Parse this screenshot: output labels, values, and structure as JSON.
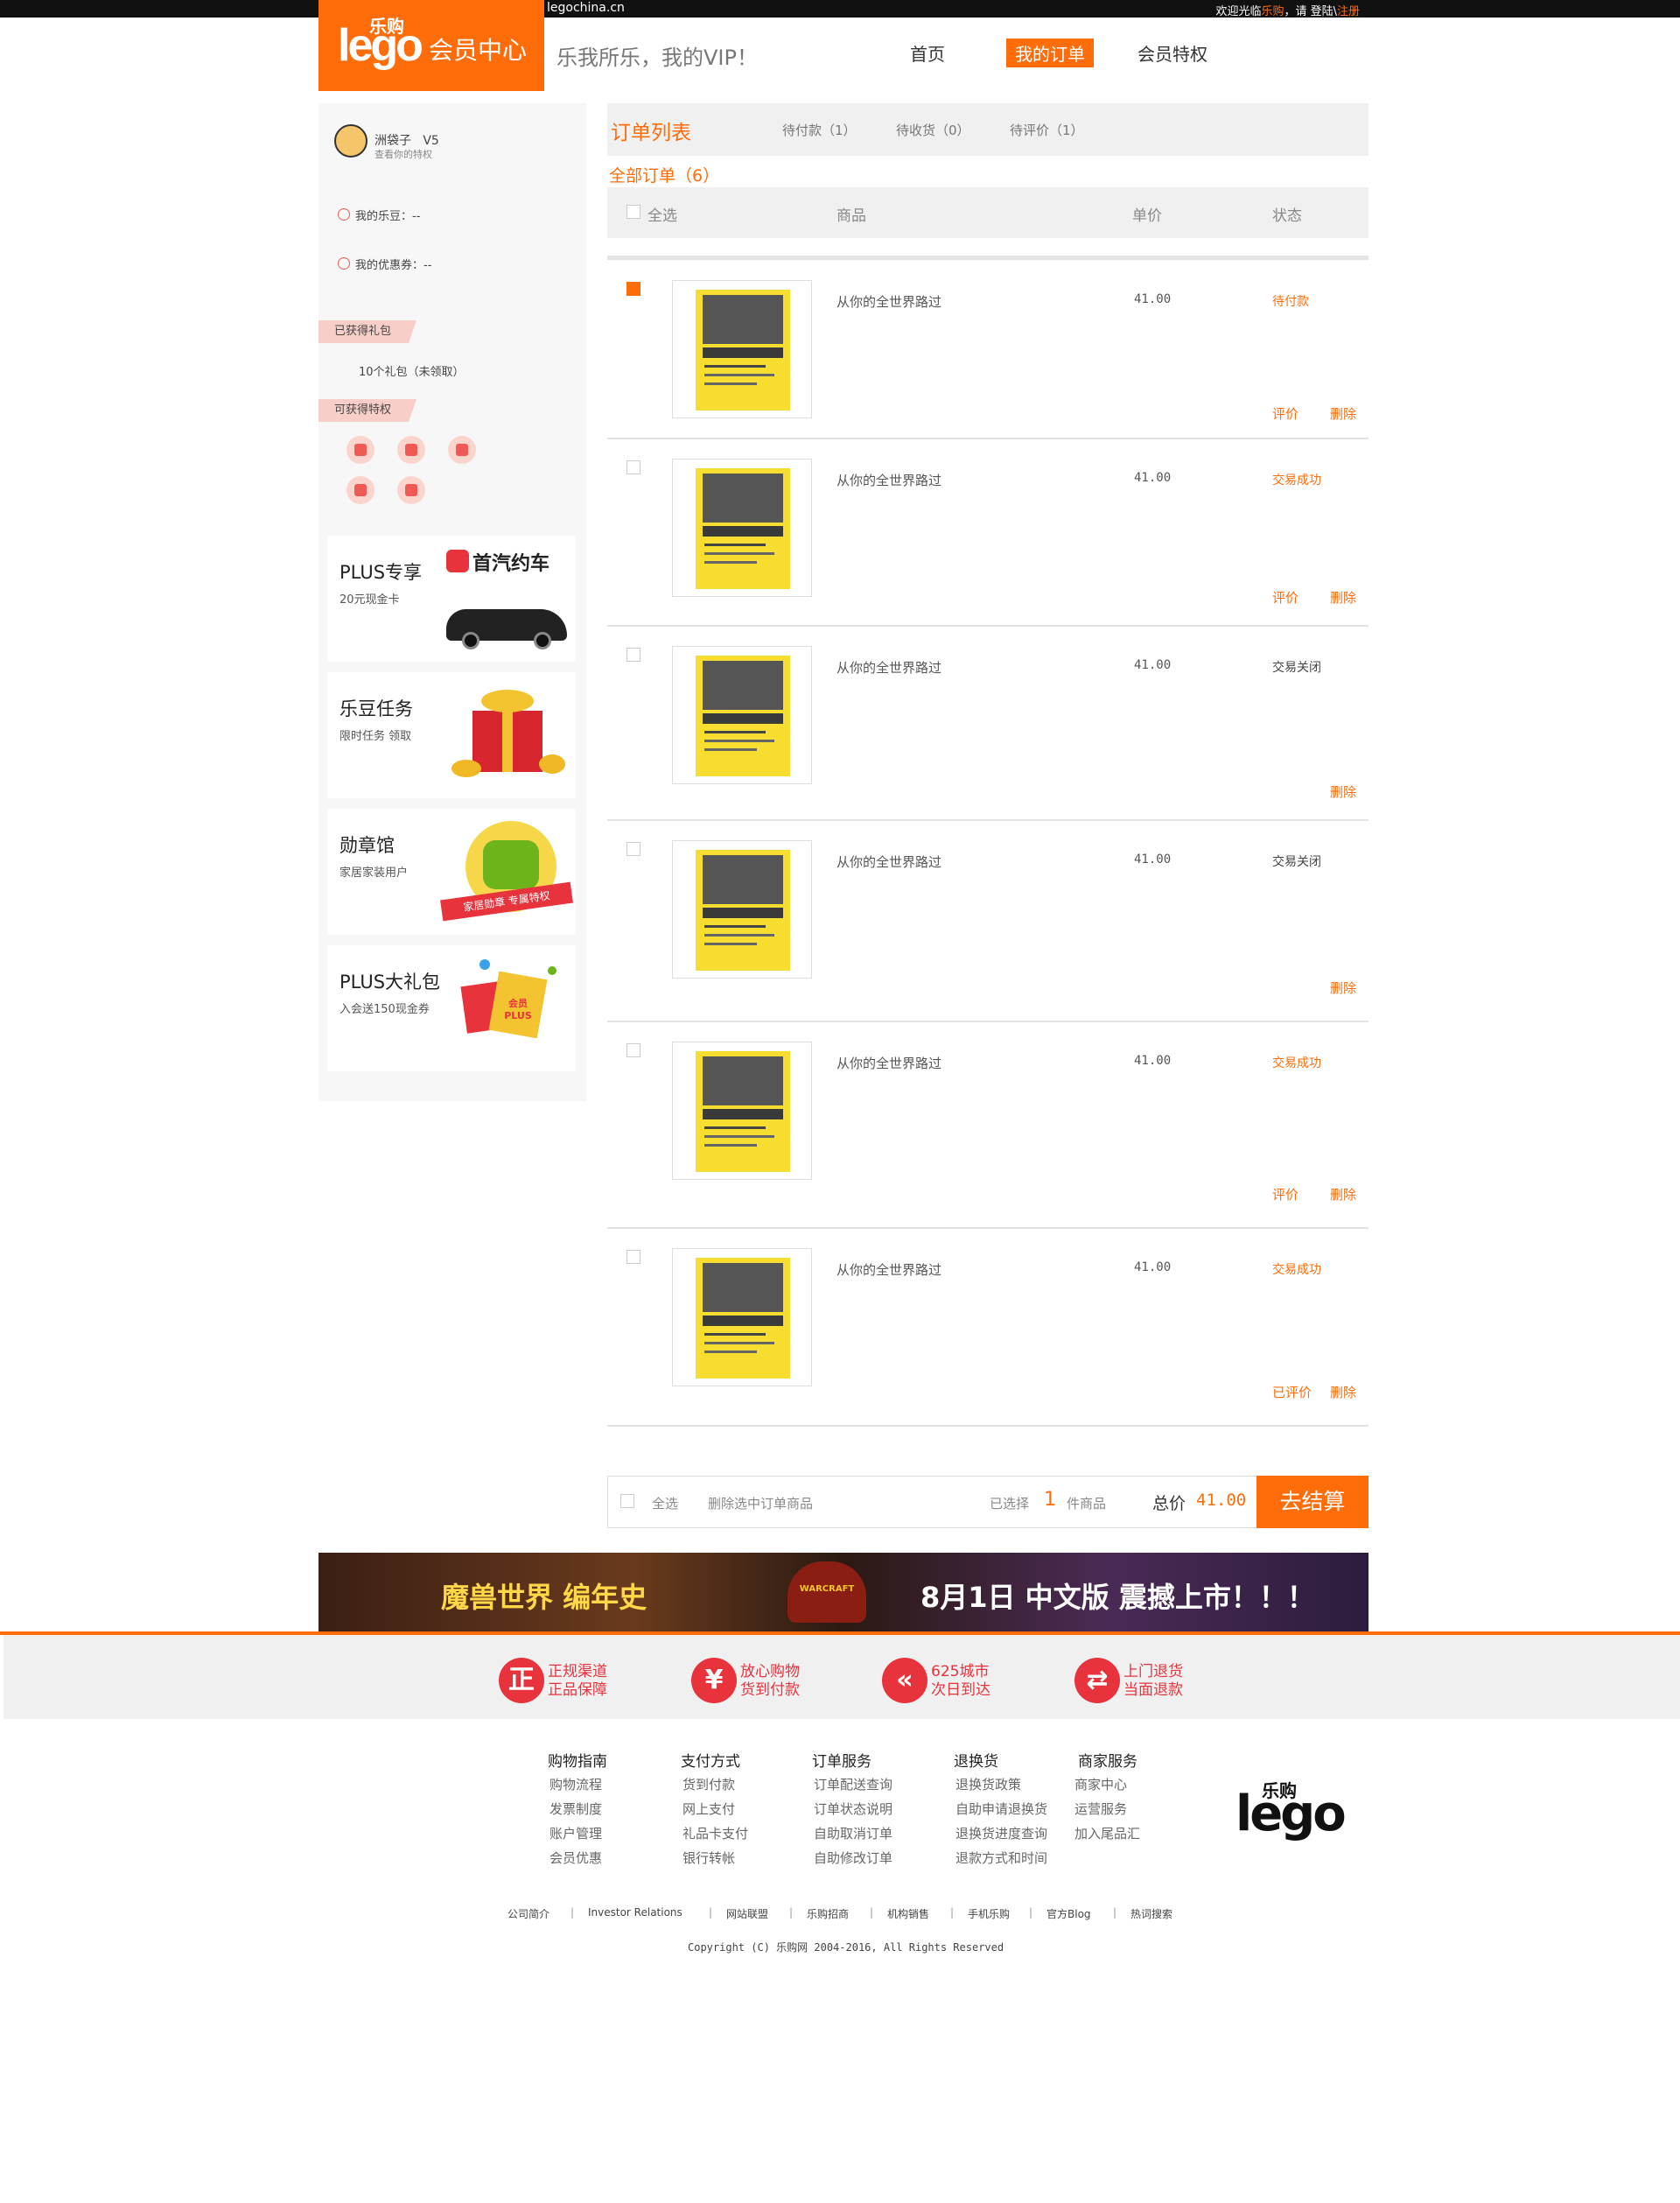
{
  "topbar": {
    "domain": "legochina.cn",
    "greeting_prefix": "欢迎光临",
    "greeting_brand": "乐购",
    "greeting_mid": "，请 登陆\\",
    "greeting_register": "注册"
  },
  "header": {
    "logo_text": "lego",
    "logo_cn": "乐购",
    "center_title": "会员中心",
    "slogan": "乐我所乐，我的VIP！",
    "nav": [
      "首页",
      "我的订单",
      "会员特权"
    ],
    "active_nav": "我的订单"
  },
  "sidebar": {
    "username": "洲袋子",
    "level": "V5",
    "view_privilege": "查看你的特权",
    "ledou_label": "我的乐豆：",
    "ledou_value": "--",
    "coupon_label": "我的优惠券：",
    "coupon_value": "--",
    "gifts_ribbon": "已获得礼包",
    "gifts_text": "10个礼包（未领取）",
    "privilege_ribbon": "可获得特权",
    "promos": [
      {
        "title": "PLUS专享",
        "subtitle": "20元现金卡",
        "brand": "首汽约车"
      },
      {
        "title": "乐豆任务",
        "subtitle": "限时任务  领取"
      },
      {
        "title": "勋章馆",
        "subtitle": "家居家装用户",
        "badge": "家居勋章 专属特权"
      },
      {
        "title": "PLUS大礼包",
        "subtitle": "入会送150现金券",
        "badge": "会员PLUS"
      }
    ]
  },
  "main": {
    "list_title": "订单列表",
    "tabs": [
      "待付款（1）",
      "待收货（0）",
      "待评价（1）"
    ],
    "all_orders": "全部订单（6）",
    "columns": {
      "select_all": "全选",
      "product": "商品",
      "price": "单价",
      "status": "状态"
    },
    "orders": [
      {
        "name": "从你的全世界路过",
        "price": "41.00",
        "status": "待付款",
        "status_color": "#ff6d0a",
        "checked": true,
        "actions": [
          "评价",
          "删除"
        ]
      },
      {
        "name": "从你的全世界路过",
        "price": "41.00",
        "status": "交易成功",
        "status_color": "#ff6d0a",
        "checked": false,
        "actions": [
          "评价",
          "删除"
        ]
      },
      {
        "name": "从你的全世界路过",
        "price": "41.00",
        "status": "交易关闭",
        "status_color": "#444444",
        "checked": false,
        "actions": [
          "删除"
        ]
      },
      {
        "name": "从你的全世界路过",
        "price": "41.00",
        "status": "交易关闭",
        "status_color": "#444444",
        "checked": false,
        "actions": [
          "删除"
        ]
      },
      {
        "name": "从你的全世界路过",
        "price": "41.00",
        "status": "交易成功",
        "status_color": "#ff6d0a",
        "checked": false,
        "actions": [
          "评价",
          "删除"
        ]
      },
      {
        "name": "从你的全世界路过",
        "price": "41.00",
        "status": "交易成功",
        "status_color": "#ff6d0a",
        "checked": false,
        "actions": [
          "已评价",
          "删除"
        ]
      }
    ],
    "bottom": {
      "select_all": "全选",
      "delete_selected": "删除选中订单商品",
      "selected_prefix": "已选择",
      "selected_count": "1",
      "selected_suffix": "件商品",
      "total_label": "总价",
      "total_value": "41.00",
      "checkout": "去结算"
    }
  },
  "banner": {
    "left": "魔兽世界 编年史",
    "logo": "WARCRAFT",
    "right": "8月1日 中文版 震撼上市！！！"
  },
  "guarantee": [
    {
      "icon": "正",
      "line1": "正规渠道",
      "line2": "正品保障"
    },
    {
      "icon": "¥",
      "line1": "放心购物",
      "line2": "货到付款"
    },
    {
      "icon": "«",
      "line1": "625城市",
      "line2": "次日到达"
    },
    {
      "icon": "⇄",
      "line1": "上门退货",
      "line2": "当面退款"
    }
  ],
  "footer": {
    "columns": [
      {
        "title": "购物指南",
        "items": [
          "购物流程",
          "发票制度",
          "账户管理",
          "会员优惠"
        ]
      },
      {
        "title": "支付方式",
        "items": [
          "货到付款",
          "网上支付",
          "礼品卡支付",
          "银行转帐"
        ]
      },
      {
        "title": "订单服务",
        "items": [
          "订单配送查询",
          "订单状态说明",
          "自助取消订单",
          "自助修改订单"
        ]
      },
      {
        "title": "退换货",
        "items": [
          "退换货政策",
          "自助申请退换货",
          "退换货进度查询",
          "退款方式和时间"
        ]
      },
      {
        "title": "商家服务",
        "items": [
          "商家中心",
          "运营服务",
          "加入尾品汇"
        ]
      }
    ],
    "logo_text": "lego",
    "logo_cn": "乐购",
    "links": [
      "公司简介",
      "Investor Relations",
      "网站联盟",
      "乐购招商",
      "机构销售",
      "手机乐购",
      "官方Blog",
      "热词搜索"
    ],
    "copyright": "Copyright (C) 乐购网 2004-2016, All Rights Reserved"
  }
}
